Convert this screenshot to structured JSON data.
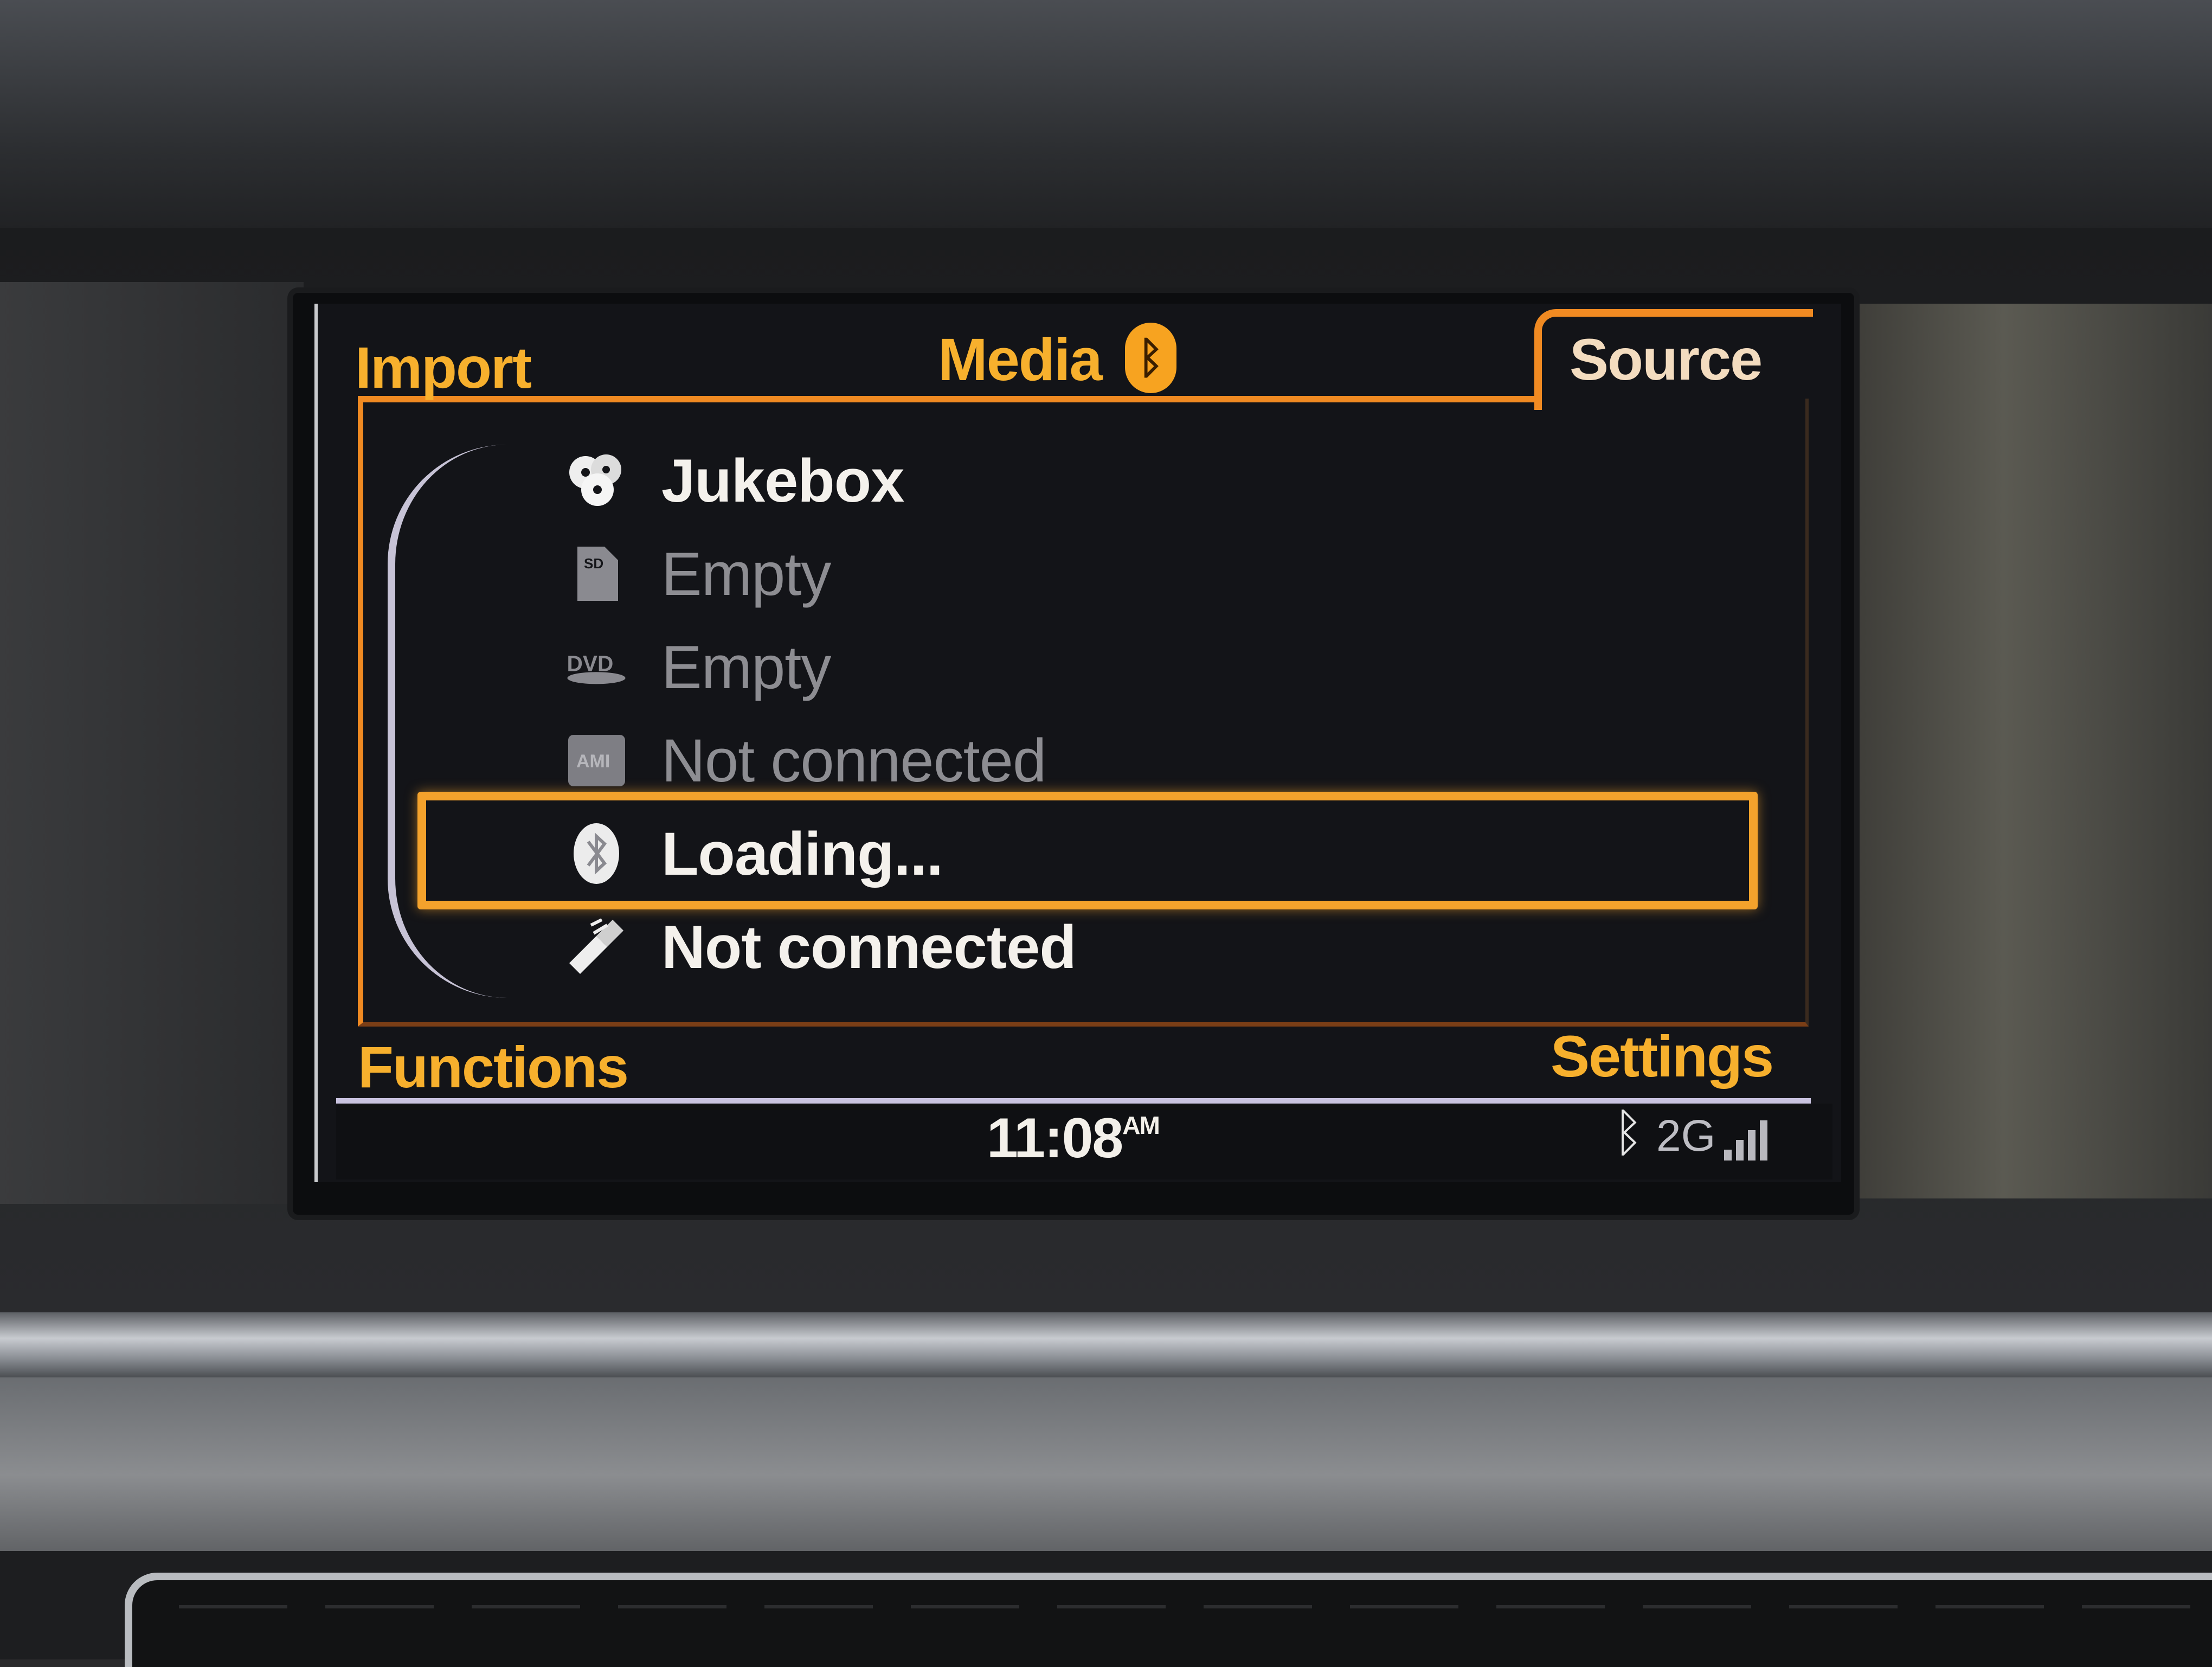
{
  "header": {
    "left_tab": "Import",
    "center_title": "Media",
    "right_tab": "Source",
    "bt_icon": "bluetooth-icon"
  },
  "source_list": {
    "items": [
      {
        "label": "Jukebox",
        "icon": "jukebox-icon",
        "state": "active"
      },
      {
        "label": "Empty",
        "icon": "sd-card-icon",
        "state": "dim"
      },
      {
        "label": "Empty",
        "icon": "dvd-icon",
        "state": "dim"
      },
      {
        "label": "Not connected",
        "icon": "ami-icon",
        "state": "dim"
      },
      {
        "label": "Loading...",
        "icon": "bluetooth-icon",
        "state": "selected"
      },
      {
        "label": "Not connected",
        "icon": "aux-input-icon",
        "state": "active"
      }
    ]
  },
  "footer": {
    "left": "Functions",
    "right": "Settings"
  },
  "status_bar": {
    "time": "11:08",
    "ampm": "AM",
    "network": "2G",
    "bt_icon": "bluetooth-icon",
    "signal_icon": "signal-strength-icon"
  },
  "colors": {
    "accent": "#f7b02d",
    "highlight": "#f4a22c",
    "text_active": "#f4f1ec",
    "text_dim": "#8d8d92",
    "screen_bg": "#131418"
  }
}
